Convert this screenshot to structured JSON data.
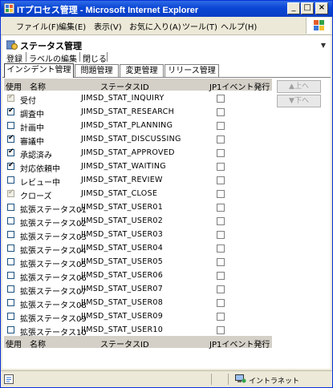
{
  "window": {
    "title": "ITプロセス管理 - Microsoft Internet Explorer",
    "minimize_label": "_",
    "maximize_label": "□",
    "close_label": "×"
  },
  "menu": [
    "ファイル(F)",
    "編集(E)",
    "表示(V)",
    "お気に入り(A)",
    "ツール(T)",
    "ヘルプ(H)"
  ],
  "page": {
    "title": "ステータス管理",
    "toolbar": [
      "登録",
      "ラベルの編集",
      "閉じる"
    ]
  },
  "tabs": [
    "インシデント管理",
    "問題管理",
    "変更管理",
    "リリース管理"
  ],
  "active_tab": 0,
  "table": {
    "columns": [
      "使用",
      "名称",
      "ステータスID",
      "JP1イベント発行"
    ],
    "rows": [
      {
        "name": "受付",
        "id": "JIMSD_STAT_INQUIRY",
        "use": true,
        "use_disabled": true,
        "jp1": false
      },
      {
        "name": "調査中",
        "id": "JIMSD_STAT_RESEARCH",
        "use": true,
        "use_disabled": false,
        "jp1": false
      },
      {
        "name": "計画中",
        "id": "JIMSD_STAT_PLANNING",
        "use": false,
        "use_disabled": false,
        "jp1": false
      },
      {
        "name": "審議中",
        "id": "JIMSD_STAT_DISCUSSING",
        "use": true,
        "use_disabled": false,
        "jp1": false
      },
      {
        "name": "承認済み",
        "id": "JIMSD_STAT_APPROVED",
        "use": true,
        "use_disabled": false,
        "jp1": false
      },
      {
        "name": "対応依頼中",
        "id": "JIMSD_STAT_WAITING",
        "use": true,
        "use_disabled": false,
        "jp1": false
      },
      {
        "name": "レビュー中",
        "id": "JIMSD_STAT_REVIEW",
        "use": false,
        "use_disabled": false,
        "jp1": false
      },
      {
        "name": "クローズ",
        "id": "JIMSD_STAT_CLOSE",
        "use": true,
        "use_disabled": true,
        "jp1": false
      },
      {
        "name": "拡張ステータス01",
        "id": "JIMSD_STAT_USER01",
        "use": false,
        "use_disabled": false,
        "jp1": false
      },
      {
        "name": "拡張ステータス02",
        "id": "JIMSD_STAT_USER02",
        "use": false,
        "use_disabled": false,
        "jp1": false
      },
      {
        "name": "拡張ステータス03",
        "id": "JIMSD_STAT_USER03",
        "use": false,
        "use_disabled": false,
        "jp1": false
      },
      {
        "name": "拡張ステータス04",
        "id": "JIMSD_STAT_USER04",
        "use": false,
        "use_disabled": false,
        "jp1": false
      },
      {
        "name": "拡張ステータス05",
        "id": "JIMSD_STAT_USER05",
        "use": false,
        "use_disabled": false,
        "jp1": false
      },
      {
        "name": "拡張ステータス06",
        "id": "JIMSD_STAT_USER06",
        "use": false,
        "use_disabled": false,
        "jp1": false
      },
      {
        "name": "拡張ステータス07",
        "id": "JIMSD_STAT_USER07",
        "use": false,
        "use_disabled": false,
        "jp1": false
      },
      {
        "name": "拡張ステータス08",
        "id": "JIMSD_STAT_USER08",
        "use": false,
        "use_disabled": false,
        "jp1": false
      },
      {
        "name": "拡張ステータス09",
        "id": "JIMSD_STAT_USER09",
        "use": false,
        "use_disabled": false,
        "jp1": false
      },
      {
        "name": "拡張ステータス10",
        "id": "JIMSD_STAT_USER10",
        "use": false,
        "use_disabled": false,
        "jp1": false
      }
    ]
  },
  "side_buttons": {
    "up": "▲上へ",
    "down": "▼下へ"
  },
  "status_bar": {
    "zone": "イントラネット"
  },
  "colors": {
    "titlebar": "#0a46d4",
    "header_row": "#d4d0c8",
    "disabled": "#a0a0a0"
  },
  "icons": {
    "app": "ie-icon",
    "page": "status-admin-icon",
    "zone": "intranet-icon"
  }
}
